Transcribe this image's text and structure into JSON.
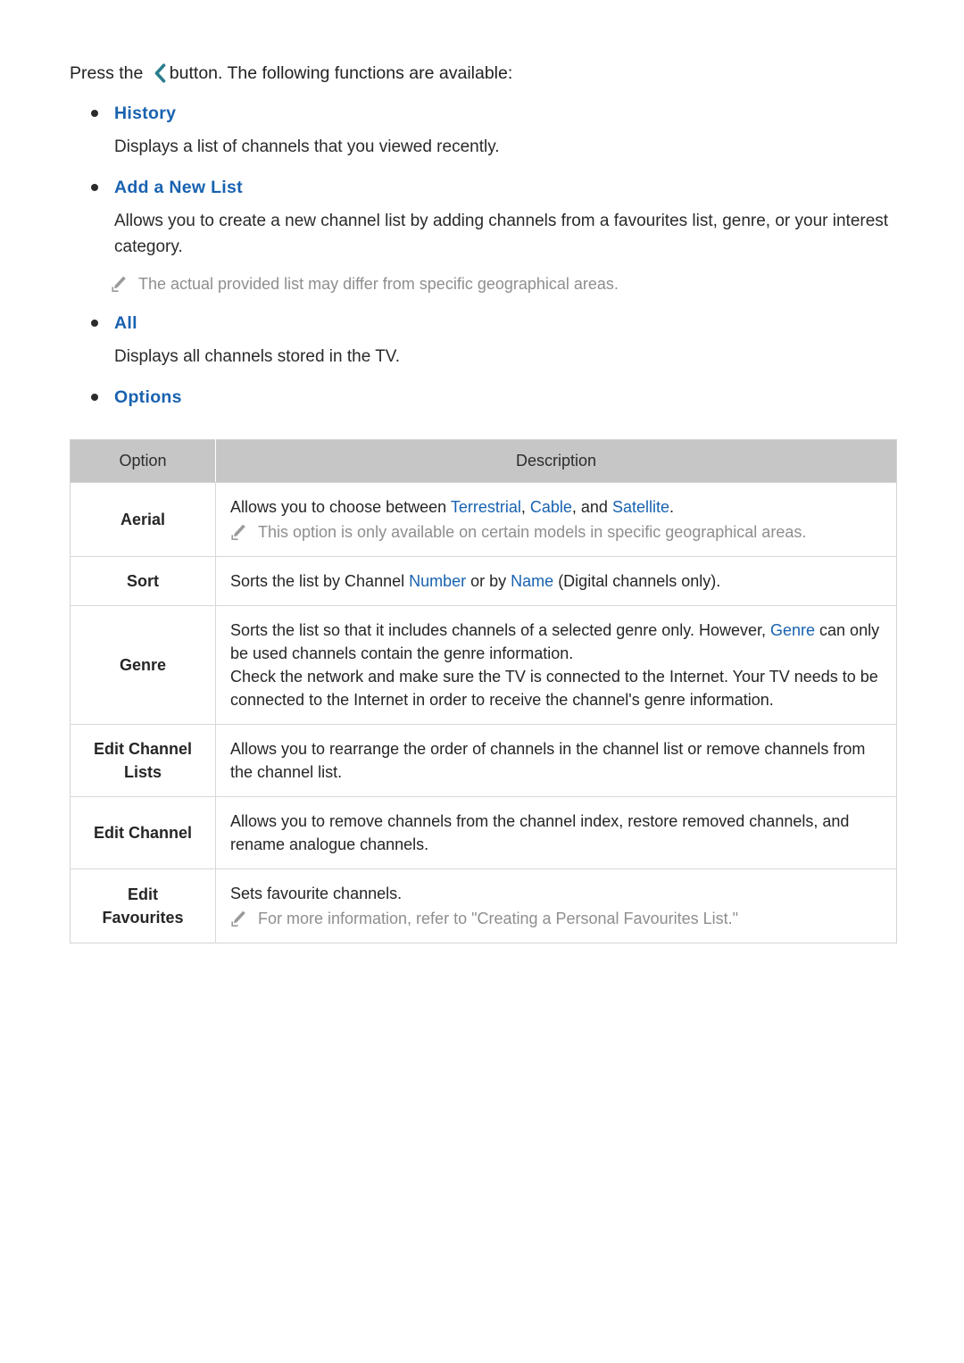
{
  "intro": {
    "before_icon": "Press the ",
    "icon": "back-chevron-icon",
    "after_icon": "button. The following functions are available:"
  },
  "sections": [
    {
      "label": "History",
      "body": "Displays a list of channels that you viewed recently."
    },
    {
      "label": "Add a New List",
      "body": "Allows you to create a new channel list by adding channels from a favourites list, genre, or your interest category.",
      "note": "The actual provided list may differ from specific geographical areas."
    },
    {
      "label": "All",
      "body": "Displays all channels stored in the TV."
    },
    {
      "label": "Options"
    }
  ],
  "table": {
    "headers": [
      "Option",
      "Description"
    ],
    "rows": [
      {
        "option": "Aerial",
        "desc_pre": "Allows you to choose between ",
        "kw1": "Terrestrial",
        "desc_mid1": ", ",
        "kw2": "Cable",
        "desc_mid2": ", and ",
        "kw3": "Satellite",
        "desc_post": ".",
        "note": "This option is only available on certain models in specific geographical areas."
      },
      {
        "option": "Sort",
        "desc_pre": "Sorts the list by Channel ",
        "kw1": "Number",
        "desc_mid1": " or by ",
        "kw2": "Name",
        "desc_post": " (Digital channels only)."
      },
      {
        "option": "Genre",
        "line1_pre": "Sorts the list so that it includes channels of a selected genre only. However, ",
        "line1_kw": "Genre",
        "line1_post": " can only be used channels contain the genre information.",
        "line2": "Check the network and make sure the TV is connected to the Internet. Your TV needs to be connected to the Internet in order to receive the channel's genre information."
      },
      {
        "option": "Edit Channel Lists",
        "desc": "Allows you to rearrange the order of channels in the channel list or remove channels from the channel list."
      },
      {
        "option": "Edit Channel",
        "desc": "Allows you to remove channels from the channel index, restore removed channels, and rename analogue channels."
      },
      {
        "option": "Edit Favourites",
        "desc": "Sets favourite channels.",
        "note": "For more information, refer to \"Creating a Personal Favourites List.\""
      }
    ]
  },
  "colors": {
    "link_blue": "#1862b0",
    "chevron_teal": "#2a7d8c",
    "note_gray": "#8e8e8e",
    "header_gray": "#c6c6c6",
    "body_text": "#262626"
  }
}
